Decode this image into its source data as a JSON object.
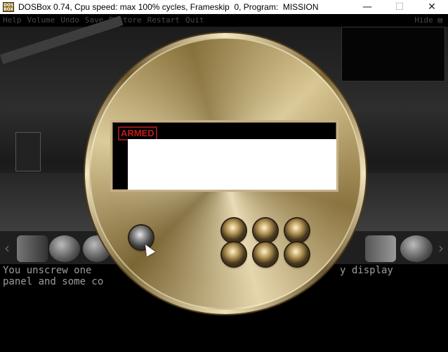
{
  "window": {
    "title": "DOSBox 0.74, Cpu speed: max 100% cycles, Frameskip  0, Program:  MISSION",
    "app_icon": "dosbox-icon",
    "app_icon_text": "DOS BOX",
    "controls": {
      "minimize": "—",
      "maximize": "☐",
      "close": "✕"
    }
  },
  "menu": {
    "items": [
      "Help",
      "Volume",
      "Undo",
      "Save",
      "Restore",
      "Restart",
      "Quit"
    ],
    "hide_label": "Hide ▤"
  },
  "bomb": {
    "display_label": "ARMED",
    "left_button_icon": "round-button",
    "keypad_button_count": 6
  },
  "message": {
    "line1": "You unscrew one",
    "line1_end": "y display",
    "line2": "panel and some co"
  },
  "colors": {
    "label_red": "#c01b1b",
    "disc_gold": "#c9b37e",
    "message_text": "#9c9c9c"
  }
}
